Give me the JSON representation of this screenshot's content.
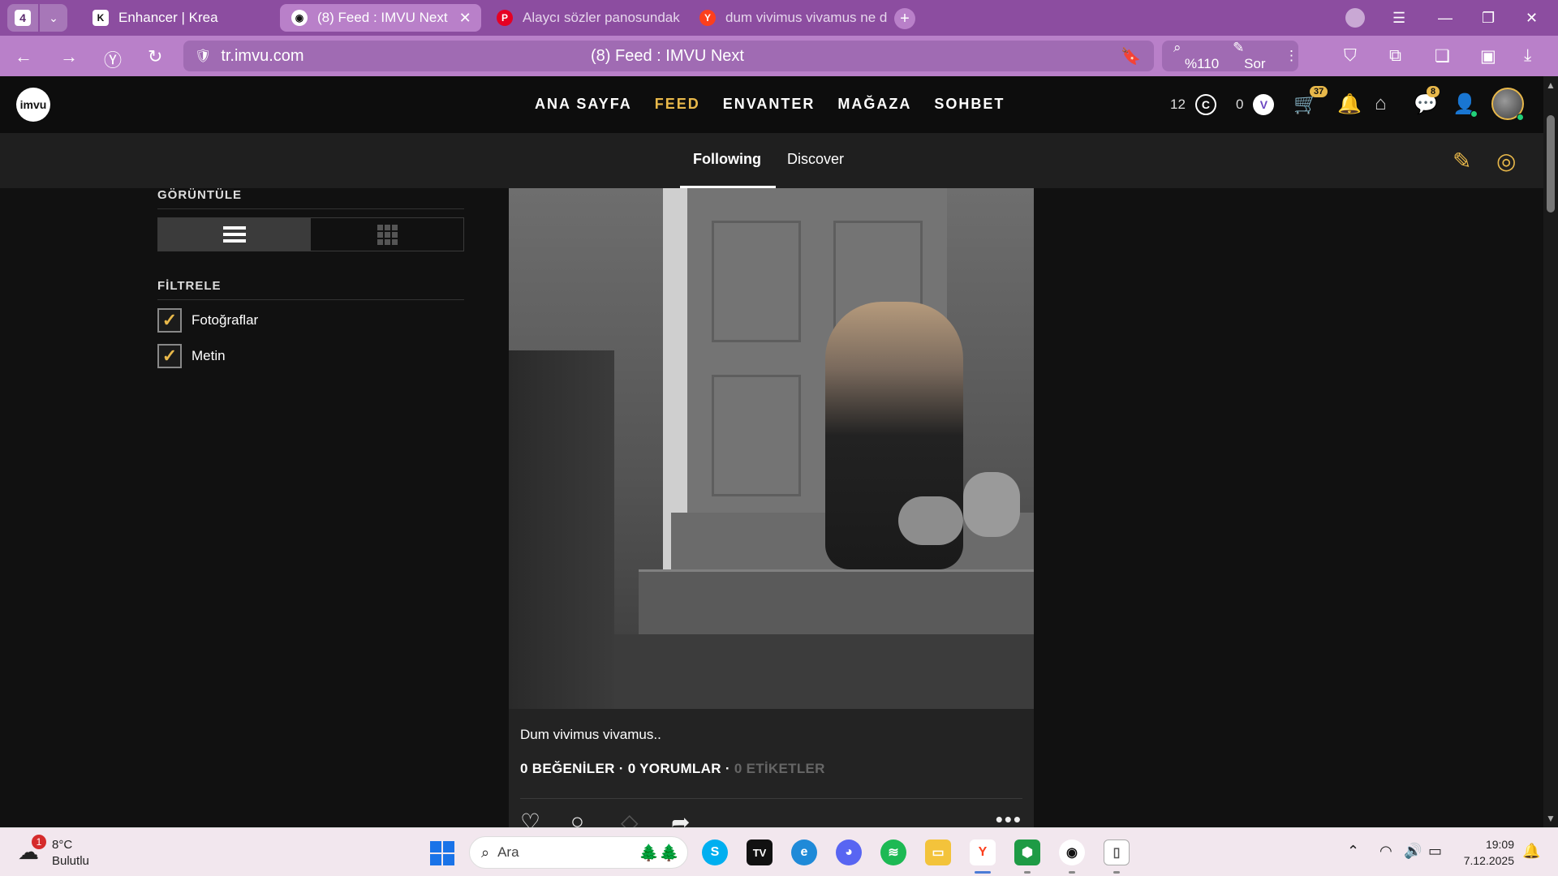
{
  "browser": {
    "tab_count": "4",
    "tabs": [
      {
        "title": "Enhancer | Krea",
        "favicon": "krea-icon"
      },
      {
        "title": "(8) Feed : IMVU Next",
        "favicon": "imvu-icon",
        "active": true
      },
      {
        "title": "Alaycı sözler panosundaki",
        "favicon": "pinterest-icon"
      },
      {
        "title": "dum vivimus vivamus ne d",
        "favicon": "yandex-icon"
      }
    ],
    "address": {
      "url": "tr.imvu.com",
      "page_title": "(8) Feed : IMVU Next"
    },
    "zoom": "%110",
    "ask_label": "Sor",
    "accent_color": "#8c4da0"
  },
  "header": {
    "logo_text": "imvu",
    "nav": [
      {
        "label": "ANA SAYFA"
      },
      {
        "label": "FEED",
        "active": true
      },
      {
        "label": "ENVANTER"
      },
      {
        "label": "MAĞAZA"
      },
      {
        "label": "SOHBET"
      }
    ],
    "credits": "12",
    "credits_icon": "C",
    "vcoin": "0",
    "vcoin_icon": "V",
    "cart_badge": "37",
    "messages_badge": "8",
    "accent_color": "#e8b84a"
  },
  "subnav": {
    "tabs": [
      {
        "label": "Following",
        "active": true
      },
      {
        "label": "Discover"
      }
    ]
  },
  "sidebar": {
    "view_title": "GÖRÜNTÜLE",
    "filter_title": "FİLTRELE",
    "filters": [
      {
        "label": "Fotoğraflar",
        "checked": true
      },
      {
        "label": "Metin",
        "checked": true
      }
    ]
  },
  "post": {
    "caption": "Dum vivimus vivamus..",
    "likes": "0 BEĞENİLER",
    "comments": "0 YORUMLAR",
    "tags": "0 ETİKETLER",
    "separator": "·"
  },
  "taskbar": {
    "weather_badge": "1",
    "temperature": "8°C",
    "condition": "Bulutlu",
    "search_placeholder": "Ara",
    "time": "19:09",
    "date": "7.12.2025"
  }
}
